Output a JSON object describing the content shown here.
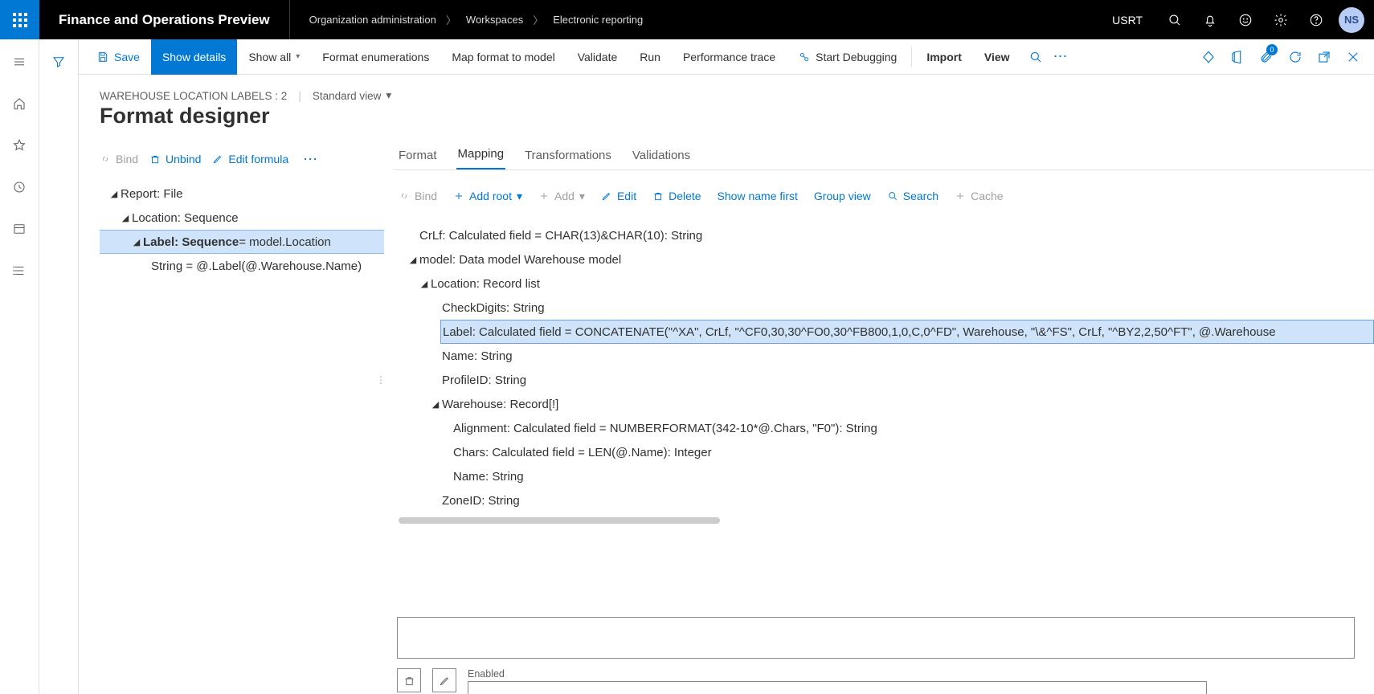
{
  "topbar": {
    "app_title": "Finance and Operations Preview",
    "breadcrumbs": [
      "Organization administration",
      "Workspaces",
      "Electronic reporting"
    ],
    "company_code": "USRT",
    "avatar_initials": "NS"
  },
  "cmdbar": {
    "save": "Save",
    "show_details": "Show details",
    "show_all": "Show all",
    "format_enums": "Format enumerations",
    "map_format": "Map format to model",
    "validate": "Validate",
    "run": "Run",
    "perf_trace": "Performance trace",
    "start_debug": "Start Debugging",
    "import": "Import",
    "view": "View",
    "attachments_badge": "0"
  },
  "page": {
    "crumb_label": "WAREHOUSE LOCATION LABELS : 2",
    "view_name": "Standard view",
    "title": "Format designer"
  },
  "left_toolbar": {
    "bind": "Bind",
    "unbind": "Unbind",
    "edit_formula": "Edit formula"
  },
  "left_tree": {
    "n0": "Report: File",
    "n1": "Location: Sequence",
    "n2_strong": "Label: Sequence",
    "n2_rest": " = model.Location",
    "n3": "String = @.Label(@.Warehouse.Name)"
  },
  "tabs": {
    "format": "Format",
    "mapping": "Mapping",
    "transformations": "Transformations",
    "validations": "Validations"
  },
  "right_toolbar": {
    "bind": "Bind",
    "add_root": "Add root",
    "add": "Add",
    "edit": "Edit",
    "delete": "Delete",
    "show_name_first": "Show name first",
    "group_view": "Group view",
    "search": "Search",
    "cache": "Cache"
  },
  "right_tree": {
    "n0": "CrLf: Calculated field = CHAR(13)&CHAR(10): String",
    "n1": "model: Data model Warehouse model",
    "n2": "Location: Record list",
    "n3": "CheckDigits: String",
    "n4": "Label: Calculated field = CONCATENATE(\"^XA\", CrLf, \"^CF0,30,30^FO0,30^FB800,1,0,C,0^FD\", Warehouse, \"\\&^FS\", CrLf, \"^BY2,2,50^FT\", @.Warehouse",
    "n5": "Name: String",
    "n6": "ProfileID: String",
    "n7": "Warehouse: Record[!]",
    "n8": "Alignment: Calculated field = NUMBERFORMAT(342-10*@.Chars, \"F0\"): String",
    "n9": "Chars: Calculated field = LEN(@.Name): Integer",
    "n10": "Name: String",
    "n11": "ZoneID: String"
  },
  "bottom": {
    "enabled_label": "Enabled"
  }
}
